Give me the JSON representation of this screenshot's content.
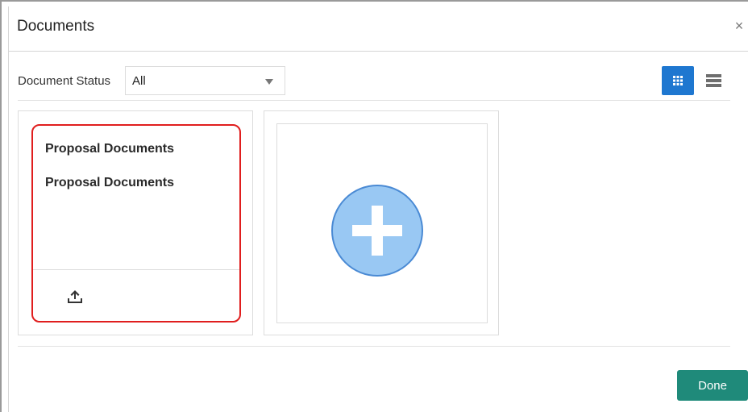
{
  "dialog": {
    "title": "Documents",
    "close_label": "×"
  },
  "filter": {
    "label": "Document Status",
    "selected": "All"
  },
  "view_toggle": {
    "active": "grid",
    "grid_icon": "grid-view-icon",
    "list_icon": "list-view-icon"
  },
  "documents": [
    {
      "title": "Proposal Documents",
      "subtitle": "Proposal Documents",
      "action_icon": "upload-icon"
    }
  ],
  "add_card": {
    "icon": "add-circle-icon"
  },
  "footer": {
    "done_label": "Done"
  },
  "colors": {
    "primary_blue": "#1e77d0",
    "done_green": "#1f8a7a",
    "highlight_red": "#e01e1e",
    "add_circle_fill": "#99c8f3",
    "add_circle_stroke": "#4a8ad4"
  }
}
